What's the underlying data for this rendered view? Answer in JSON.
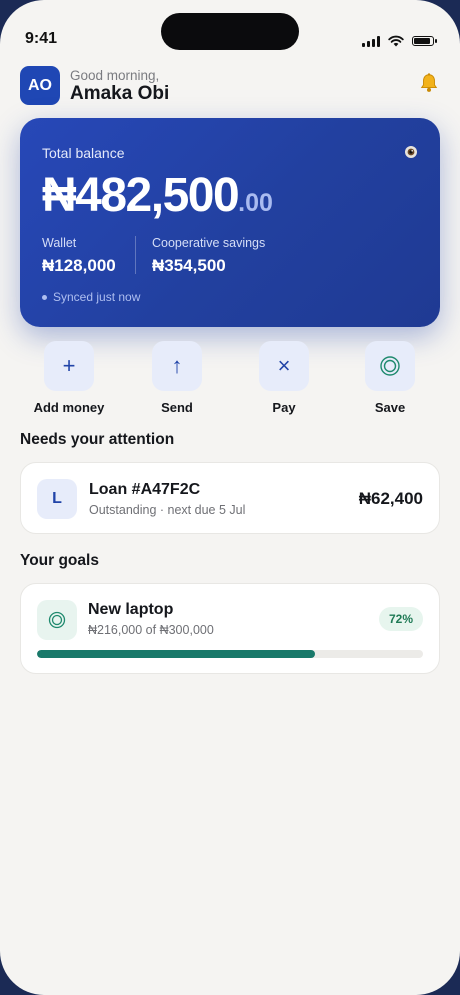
{
  "status_bar": {
    "time": "9:41"
  },
  "header": {
    "avatar_initials": "AO",
    "greeting": "Good morning,",
    "user_name": "Amaka Obi",
    "notification_icon": "bell-icon"
  },
  "balance_card": {
    "label": "Total balance",
    "amount_main": "₦482,500",
    "amount_decimal": ".00",
    "wallet": {
      "label": "Wallet",
      "value": "₦128,000"
    },
    "cooperative": {
      "label": "Cooperative savings",
      "value": "₦354,500"
    },
    "sync_status": "Synced just now",
    "visibility_icon": "eye-icon"
  },
  "quick_actions": [
    {
      "label": "Add money",
      "icon": "plus-icon",
      "glyph": "+"
    },
    {
      "label": "Send",
      "icon": "arrow-up-icon",
      "glyph": "↑"
    },
    {
      "label": "Pay",
      "icon": "close-icon",
      "glyph": "×"
    },
    {
      "label": "Save",
      "icon": "target-icon",
      "glyph": ""
    }
  ],
  "attention": {
    "title": "Needs your attention",
    "loan": {
      "icon_letter": "L",
      "title": "Loan #A47F2C",
      "subtitle": "Outstanding · next due 5 Jul",
      "amount": "₦62,400"
    }
  },
  "goals": {
    "title": "Your goals",
    "items": [
      {
        "title": "New laptop",
        "subtitle": "₦216,000 of ₦300,000",
        "percent_label": "72%",
        "progress": 0.72,
        "icon": "target-icon"
      }
    ]
  },
  "colors": {
    "accent": "#2144a8",
    "card_blue": "#2748b8",
    "progress_green": "#19796a",
    "background": "#f5f4f2"
  }
}
